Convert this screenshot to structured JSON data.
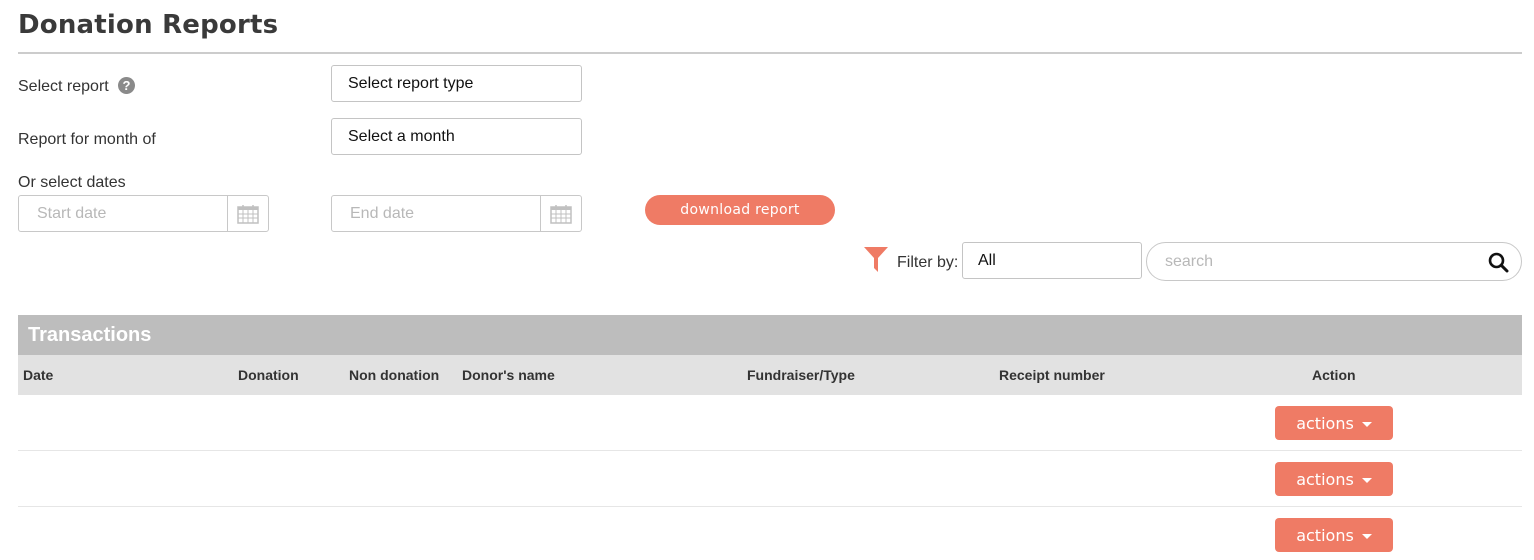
{
  "page": {
    "title": "Donation Reports"
  },
  "form": {
    "select_report_label": "Select report",
    "help_glyph": "?",
    "report_type_value": "Select report type",
    "month_label": "Report for month of",
    "month_value": "Select a month",
    "dates_label": "Or select dates",
    "start_date_placeholder": "Start date",
    "end_date_placeholder": "End date",
    "download_label": "download report"
  },
  "filter": {
    "label": "Filter by:",
    "value": "All",
    "search_placeholder": "search"
  },
  "table": {
    "title": "Transactions",
    "columns": [
      "Date",
      "Donation",
      "Non donation",
      "Donor's name",
      "Fundraiser/Type",
      "Receipt number",
      "Action"
    ],
    "rows": [
      {
        "action_label": "actions"
      },
      {
        "action_label": "actions"
      },
      {
        "action_label": "actions"
      }
    ]
  },
  "colors": {
    "accent": "#ef7b65",
    "table_title_bg": "#bdbdbd",
    "table_header_bg": "#e2e2e2"
  }
}
